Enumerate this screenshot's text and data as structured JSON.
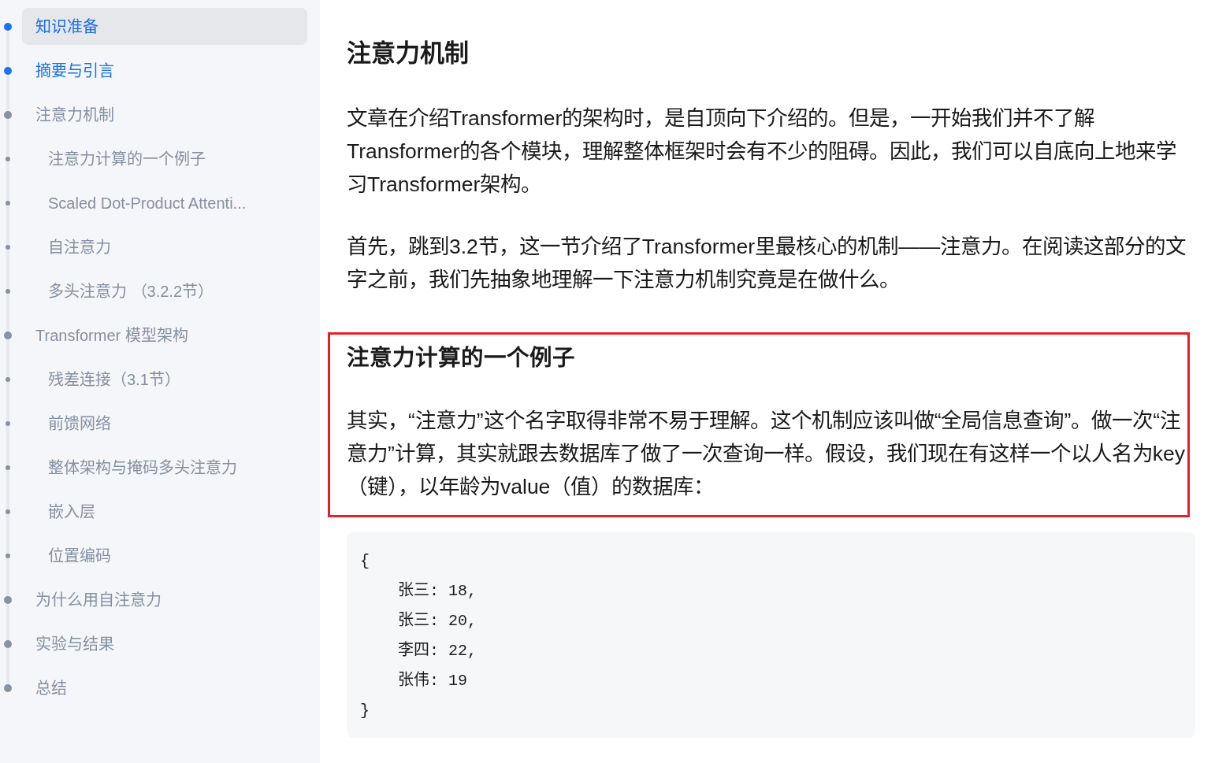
{
  "toc": {
    "items": [
      {
        "label": "知识准备",
        "selected": true,
        "active": true
      },
      {
        "label": "摘要与引言",
        "selected": false,
        "active": true
      },
      {
        "label": "注意力机制",
        "selected": false,
        "active": false,
        "children": [
          {
            "label": "注意力计算的一个例子",
            "selected": false,
            "active": false
          },
          {
            "label": "Scaled Dot-Product Attenti...",
            "selected": false,
            "active": false
          },
          {
            "label": "自注意力",
            "selected": false,
            "active": false
          },
          {
            "label": "多头注意力 （3.2.2节）",
            "selected": false,
            "active": false
          }
        ]
      },
      {
        "label": "Transformer 模型架构",
        "selected": false,
        "active": false,
        "children": [
          {
            "label": "残差连接（3.1节）",
            "selected": false,
            "active": false
          },
          {
            "label": "前馈网络",
            "selected": false,
            "active": false
          },
          {
            "label": "整体架构与掩码多头注意力",
            "selected": false,
            "active": false
          },
          {
            "label": "嵌入层",
            "selected": false,
            "active": false
          },
          {
            "label": "位置编码",
            "selected": false,
            "active": false
          }
        ]
      },
      {
        "label": "为什么用自注意力",
        "selected": false,
        "active": false
      },
      {
        "label": "实验与结果",
        "selected": false,
        "active": false
      },
      {
        "label": "总结",
        "selected": false,
        "active": false
      }
    ]
  },
  "article": {
    "heading": "注意力机制",
    "paragraphs": [
      "文章在介绍Transformer的架构时，是自顶向下介绍的。但是，一开始我们并不了解Transformer的各个模块，理解整体框架时会有不少的阻碍。因此，我们可以自底向上地来学习Transformer架构。",
      "首先，跳到3.2节，这一节介绍了Transformer里最核心的机制——注意力。在阅读这部分的文字之前，我们先抽象地理解一下注意力机制究竟是在做什么。"
    ],
    "subsection": {
      "heading": "注意力计算的一个例子",
      "outlined": true,
      "paragraphs": [
        "其实，“注意力”这个名字取得非常不易于理解。这个机制应该叫做“全局信息查询”。做一次“注意力”计算，其实就跟去数据库了做了一次查询一样。假设，我们现在有这样一个以人名为key（键），以年龄为value（值）的数据库："
      ]
    },
    "code_block": {
      "lines": [
        "{",
        "    张三: 18,",
        "    张三: 20,",
        "    李四: 22,",
        "    张伟: 19",
        "}"
      ]
    }
  }
}
